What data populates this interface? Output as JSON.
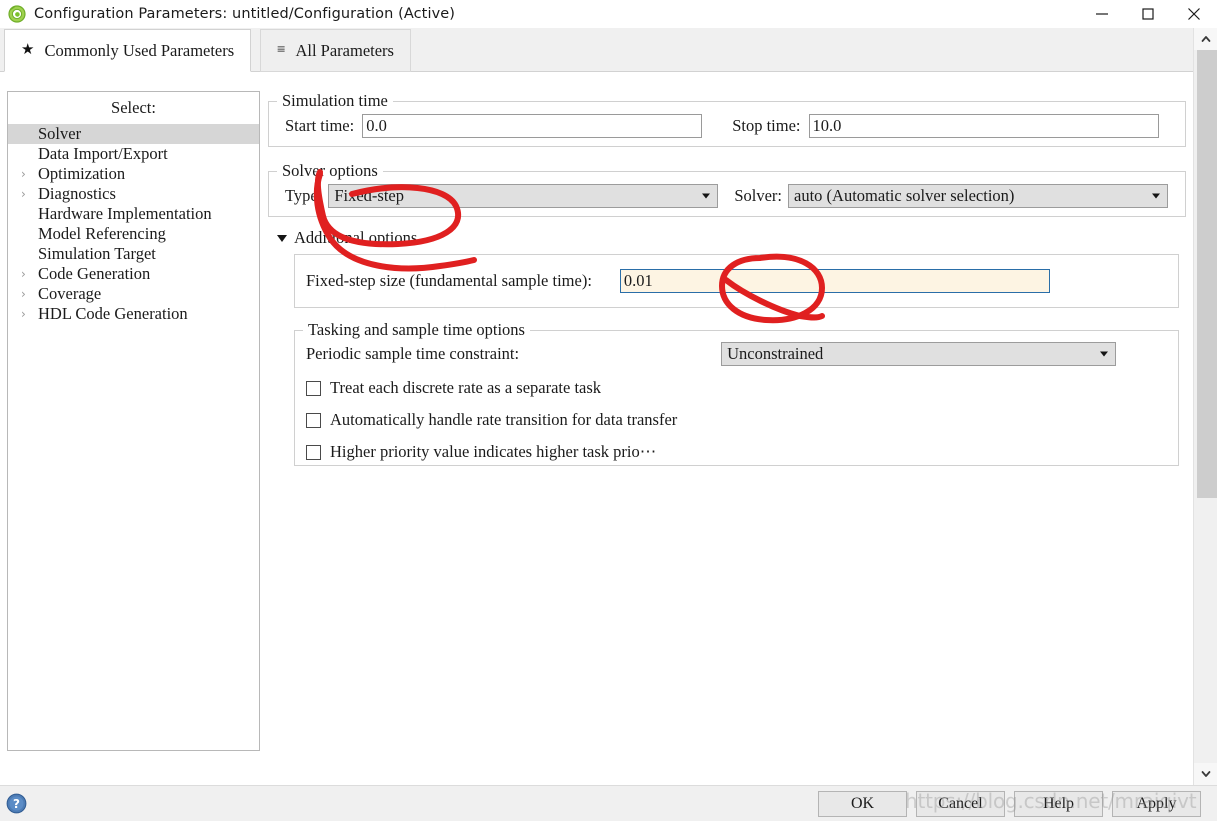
{
  "window": {
    "title": "Configuration Parameters: untitled/Configuration (Active)",
    "icon": "simulink-icon",
    "minimize": "─",
    "maximize": "□",
    "close": "✕"
  },
  "tabs": [
    {
      "label": "Commonly Used Parameters",
      "icon": "star-icon",
      "glyph": "★",
      "active": true
    },
    {
      "label": "All Parameters",
      "icon": "list-icon",
      "glyph": "≡",
      "active": false
    }
  ],
  "sidebar": {
    "title": "Select:",
    "items": [
      {
        "label": "Solver",
        "expandable": false,
        "selected": true
      },
      {
        "label": "Data Import/Export",
        "expandable": false,
        "selected": false
      },
      {
        "label": "Optimization",
        "expandable": true,
        "selected": false
      },
      {
        "label": "Diagnostics",
        "expandable": true,
        "selected": false
      },
      {
        "label": "Hardware Implementation",
        "expandable": false,
        "selected": false
      },
      {
        "label": "Model Referencing",
        "expandable": false,
        "selected": false
      },
      {
        "label": "Simulation Target",
        "expandable": false,
        "selected": false
      },
      {
        "label": "Code Generation",
        "expandable": true,
        "selected": false
      },
      {
        "label": "Coverage",
        "expandable": true,
        "selected": false
      },
      {
        "label": "HDL Code Generation",
        "expandable": true,
        "selected": false
      }
    ],
    "arrow_glyph": "›"
  },
  "simulation_time": {
    "legend": "Simulation time",
    "start_label": "Start time:",
    "start_value": "0.0",
    "stop_label": "Stop time:",
    "stop_value": "10.0"
  },
  "solver_options": {
    "legend": "Solver options",
    "type_label": "Type:",
    "type_value": "Fixed-step",
    "solver_label": "Solver:",
    "solver_value": "auto (Automatic solver selection)"
  },
  "additional_options": {
    "label": "Additional options",
    "expanded": true,
    "fixed_step_label": "Fixed-step size (fundamental sample time):",
    "fixed_step_value": "0.01"
  },
  "tasking": {
    "legend": "Tasking and sample time options",
    "constraint_label": "Periodic sample time constraint:",
    "constraint_value": "Unconstrained",
    "checkboxes": [
      {
        "label": "Treat each discrete rate as a separate task",
        "checked": false
      },
      {
        "label": "Automatically handle rate transition for data transfer",
        "checked": false
      },
      {
        "label": "Higher priority value indicates higher task prio⋯",
        "checked": false
      }
    ]
  },
  "footer": {
    "help_icon": "help-question-icon",
    "buttons": [
      {
        "label": "OK"
      },
      {
        "label": "Cancel"
      },
      {
        "label": "Help"
      },
      {
        "label": "Apply"
      }
    ]
  },
  "watermark": {
    "text": "https://blog.csdn.net/mraiqivt"
  },
  "annotations": {
    "color": "#e02020",
    "marks": [
      {
        "name": "circle-around-solver-type",
        "target": "Fixed-step"
      },
      {
        "name": "circle-around-fixed-step-size",
        "target": "0.01"
      }
    ]
  },
  "scrollbar": {
    "up_glyph": "⌃",
    "down_glyph": "⌄"
  }
}
